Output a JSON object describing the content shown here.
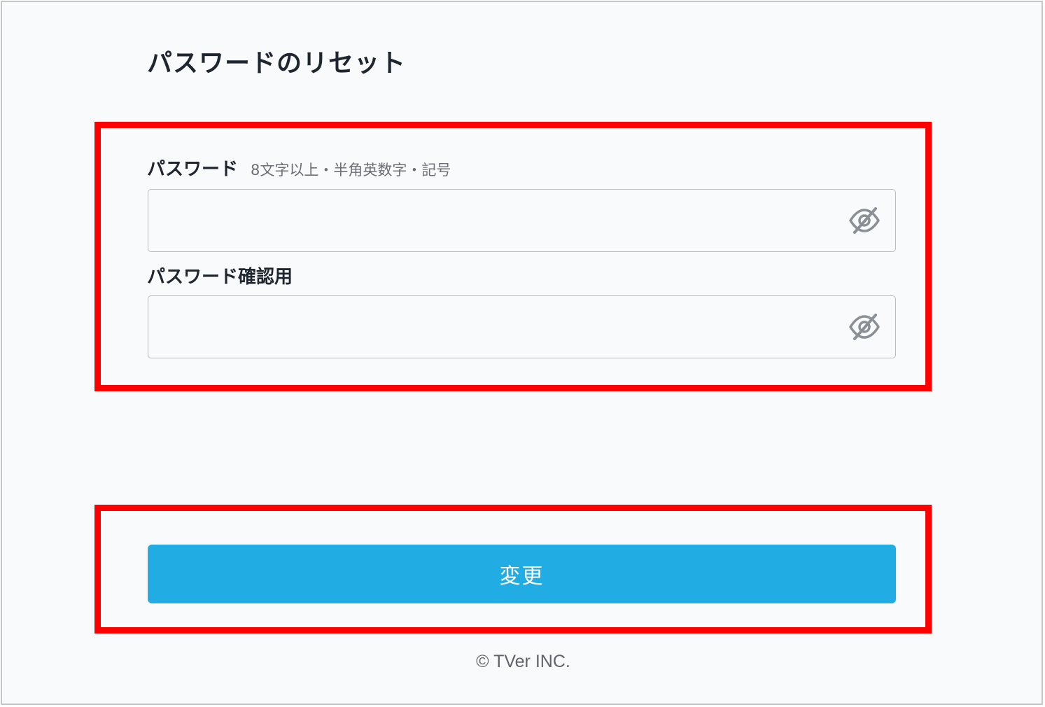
{
  "page": {
    "title": "パスワードのリセット"
  },
  "form": {
    "password": {
      "label": "パスワード",
      "hint": "8文字以上・半角英数字・記号",
      "value": "",
      "visibility_icon": "eye-slash-icon"
    },
    "password_confirm": {
      "label": "パスワード確認用",
      "value": "",
      "visibility_icon": "eye-slash-icon"
    },
    "submit_label": "変更"
  },
  "footer": {
    "copyright": "© TVer INC."
  },
  "colors": {
    "accent": "#22ace4",
    "highlight": "#ff0000",
    "text": "#1f2630",
    "background": "#f9fafb"
  }
}
